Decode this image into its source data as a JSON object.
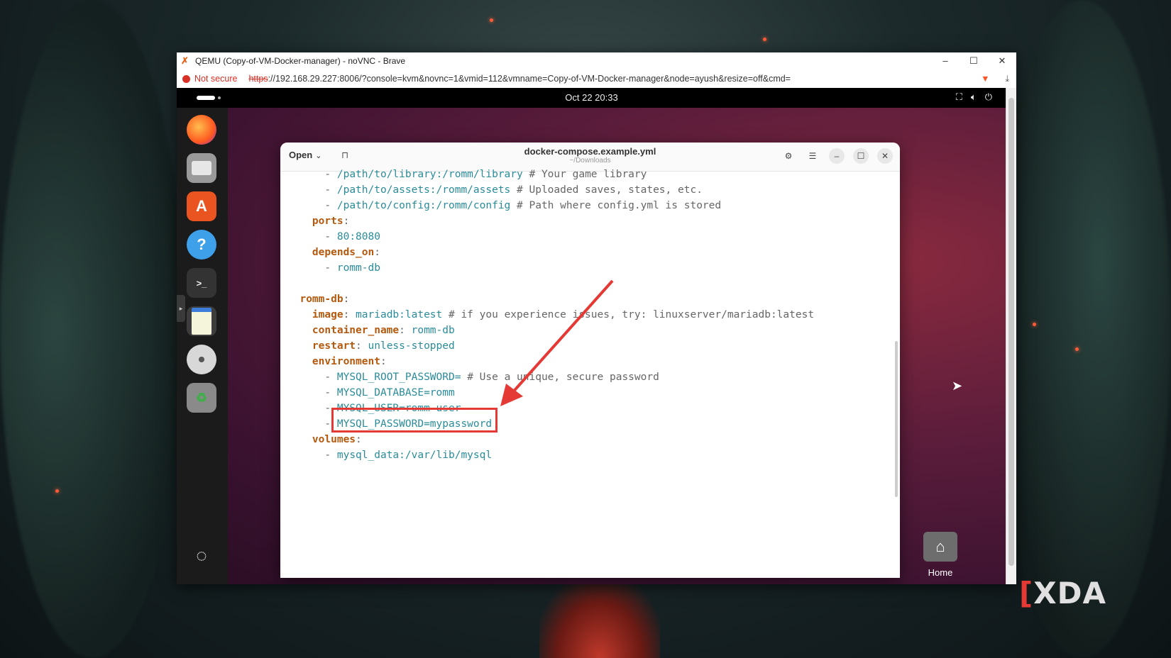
{
  "browser": {
    "title": "QEMU (Copy-of-VM-Docker-manager) - noVNC - Brave",
    "security_label": "Not secure",
    "url_scheme": "https",
    "url_rest": "://192.168.29.227:8006/?console=kvm&novnc=1&vmid=112&vmname=Copy-of-VM-Docker-manager&node=ayush&resize=off&cmd=",
    "controls": {
      "minimize": "–",
      "maximize": "☐",
      "close": "✕"
    }
  },
  "gnome": {
    "clock": "Oct 22  20:33",
    "tray_icons": [
      "network-icon",
      "volume-icon",
      "power-icon"
    ]
  },
  "dock": {
    "items": [
      "firefox-icon",
      "files-icon",
      "app-center-icon",
      "help-icon",
      "terminal-icon",
      "text-editor-icon",
      "disc-icon",
      "trash-icon"
    ],
    "show_apps": "ubuntu-logo-icon"
  },
  "editor": {
    "open_label": "Open",
    "filename": "docker-compose.example.yml",
    "path": "~/Downloads"
  },
  "code_lines": [
    {
      "indent": "      ",
      "prefix": "- ",
      "text": "/path/to/library:/romm/library",
      "comment": " # Your game library"
    },
    {
      "indent": "      ",
      "prefix": "- ",
      "text": "/path/to/assets:/romm/assets",
      "comment": " # Uploaded saves, states, etc."
    },
    {
      "indent": "      ",
      "prefix": "- ",
      "text": "/path/to/config:/romm/config",
      "comment": " # Path where config.yml is stored"
    },
    {
      "indent": "    ",
      "key": "ports",
      "text": ":"
    },
    {
      "indent": "      ",
      "prefix": "- ",
      "text": "80:8080"
    },
    {
      "indent": "    ",
      "key": "depends_on",
      "text": ":"
    },
    {
      "indent": "      ",
      "prefix": "- ",
      "text": "romm-db"
    },
    {
      "indent": "",
      "text": ""
    },
    {
      "indent": "  ",
      "key": "romm-db",
      "text": ":"
    },
    {
      "indent": "    ",
      "key": "image",
      "text": ": ",
      "value": "mariadb:latest",
      "comment": " # if you experience issues, try: linuxserver/mariadb:latest"
    },
    {
      "indent": "    ",
      "key": "container_name",
      "text": ": ",
      "value": "romm-db"
    },
    {
      "indent": "    ",
      "key": "restart",
      "text": ": ",
      "value": "unless-stopped"
    },
    {
      "indent": "    ",
      "key": "environment",
      "text": ":"
    },
    {
      "indent": "      ",
      "prefix": "- ",
      "text": "MYSQL_ROOT_PASSWORD=",
      "comment": " # Use a unique, secure password"
    },
    {
      "indent": "      ",
      "prefix": "- ",
      "text": "MYSQL_DATABASE=romm"
    },
    {
      "indent": "      ",
      "prefix": "- ",
      "text": "MYSQL_USER=romm-user"
    },
    {
      "indent": "      ",
      "prefix": "- ",
      "text": "MYSQL_PASSWORD=mypassword"
    },
    {
      "indent": "    ",
      "key": "volumes",
      "text": ":"
    },
    {
      "indent": "      ",
      "prefix": "- ",
      "text": "mysql_data:/var/lib/mysql"
    }
  ],
  "desktop": {
    "home_label": "Home"
  },
  "watermark": "XDA",
  "colors": {
    "highlight": "#e53935",
    "yaml_key": "#b4590e",
    "yaml_value": "#2a8c9a"
  }
}
